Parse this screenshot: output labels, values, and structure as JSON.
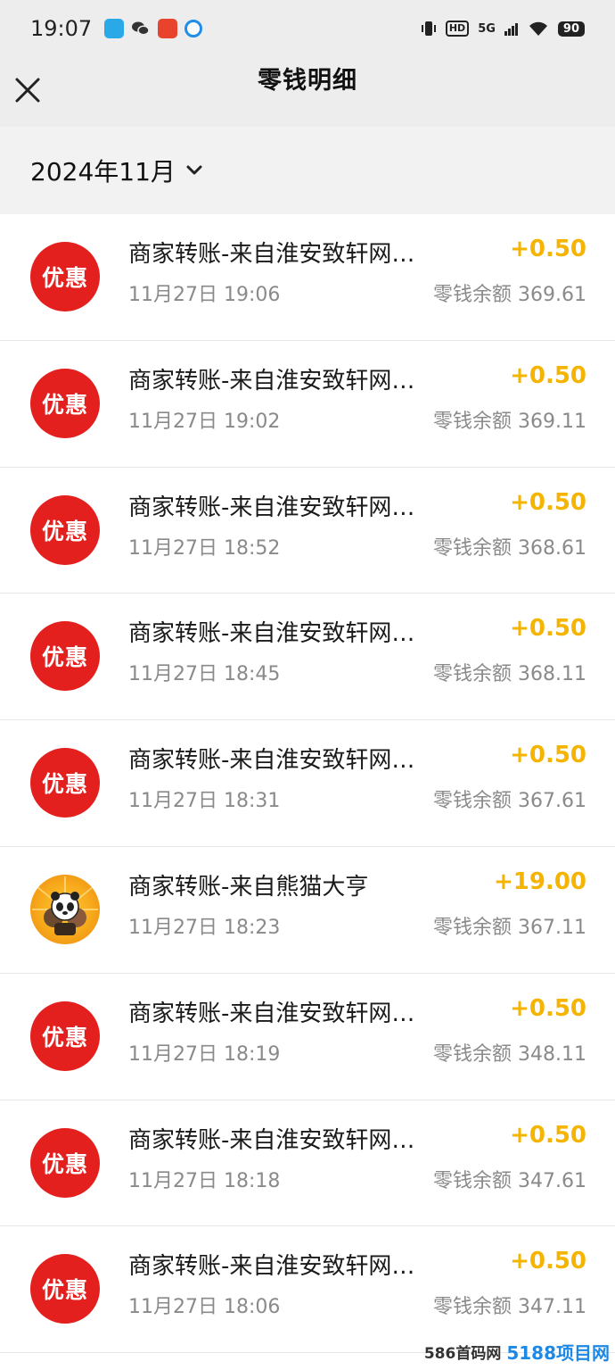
{
  "status_bar": {
    "time": "19:07",
    "hd_badge": "HD",
    "network": "5G",
    "battery": "90",
    "app_icons": [
      "message-app-icon",
      "wechat-icon",
      "red-packet-app-icon",
      "browser-app-icon"
    ]
  },
  "nav": {
    "title": "零钱明细",
    "close_icon": "close-icon"
  },
  "filter": {
    "month": "2024年11月",
    "icon": "chevron-down-icon"
  },
  "transactions": [
    {
      "avatar": "优惠",
      "title": "商家转账-来自淮安致轩网…",
      "date": "11月27日 19:06",
      "amount": "+0.50",
      "balance": "零钱余额 369.61"
    },
    {
      "avatar": "优惠",
      "title": "商家转账-来自淮安致轩网…",
      "date": "11月27日 19:02",
      "amount": "+0.50",
      "balance": "零钱余额 369.11"
    },
    {
      "avatar": "优惠",
      "title": "商家转账-来自淮安致轩网…",
      "date": "11月27日 18:52",
      "amount": "+0.50",
      "balance": "零钱余额 368.61"
    },
    {
      "avatar": "优惠",
      "title": "商家转账-来自淮安致轩网…",
      "date": "11月27日 18:45",
      "amount": "+0.50",
      "balance": "零钱余额 368.11"
    },
    {
      "avatar": "优惠",
      "title": "商家转账-来自淮安致轩网…",
      "date": "11月27日 18:31",
      "amount": "+0.50",
      "balance": "零钱余额 367.61"
    },
    {
      "avatar": "panda-avatar-icon",
      "title": "商家转账-来自熊猫大亨",
      "date": "11月27日 18:23",
      "amount": "+19.00",
      "balance": "零钱余额 367.11"
    },
    {
      "avatar": "优惠",
      "title": "商家转账-来自淮安致轩网…",
      "date": "11月27日 18:19",
      "amount": "+0.50",
      "balance": "零钱余额 348.11"
    },
    {
      "avatar": "优惠",
      "title": "商家转账-来自淮安致轩网…",
      "date": "11月27日 18:18",
      "amount": "+0.50",
      "balance": "零钱余额 347.61"
    },
    {
      "avatar": "优惠",
      "title": "商家转账-来自淮安致轩网…",
      "date": "11月27日 18:06",
      "amount": "+0.50",
      "balance": "零钱余额 347.11"
    }
  ],
  "watermark": {
    "text": "586首码网",
    "logo": "5188项目网"
  },
  "colors": {
    "amount": "#f5b400",
    "avatar_red": "#e4201e",
    "header_bg": "#ededed"
  }
}
